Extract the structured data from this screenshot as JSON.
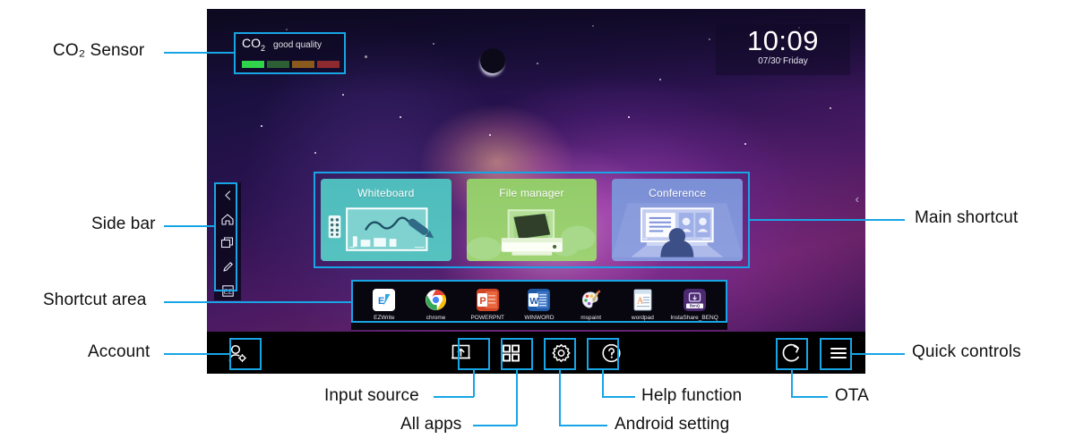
{
  "annotations": {
    "co2_sensor": "CO₂ Sensor",
    "side_bar": "Side bar",
    "shortcut_area": "Shortcut area",
    "account": "Account",
    "main_shortcut": "Main shortcut",
    "quick_controls": "Quick controls",
    "input_source": "Input source",
    "all_apps": "All apps",
    "android_setting": "Android setting",
    "help_function": "Help function",
    "ota": "OTA"
  },
  "colors": {
    "accent": "#18a5e6",
    "co2_good": "#2fd44a",
    "co2_fair": "#2f6a34",
    "co2_poor": "#8a5a1c",
    "co2_bad": "#93272c",
    "tile_whiteboard": "#4fbcbd",
    "tile_filemanager": "#93cc6a",
    "tile_conference": "#7b8fd6"
  },
  "screen": {
    "co2_widget": {
      "label": "CO",
      "label_sub": "2",
      "quality": "good quality",
      "levels": [
        "good",
        "fair",
        "poor",
        "bad"
      ],
      "active_level": 0
    },
    "clock": {
      "time": "10:09",
      "date": "07/30 Friday"
    },
    "sidebar": {
      "items": [
        {
          "name": "collapse",
          "icon": "chevron-left-icon"
        },
        {
          "name": "home",
          "icon": "home-icon"
        },
        {
          "name": "recent",
          "icon": "windows-icon"
        },
        {
          "name": "annotate",
          "icon": "pen-icon"
        },
        {
          "name": "ezwrite",
          "icon": "ez-icon"
        }
      ],
      "edge_chevron": "‹"
    },
    "main_shortcut": {
      "tiles": [
        {
          "title": "Whiteboard",
          "key": "whiteboard"
        },
        {
          "title": "File manager",
          "key": "file-manager"
        },
        {
          "title": "Conference",
          "key": "conference"
        }
      ]
    },
    "shortcut_area": {
      "apps": [
        {
          "label": "EZWrite",
          "icon": "ezwrite-icon"
        },
        {
          "label": "chrome",
          "icon": "chrome-icon"
        },
        {
          "label": "POWERPNT",
          "icon": "powerpoint-icon"
        },
        {
          "label": "WINWORD",
          "icon": "word-icon"
        },
        {
          "label": "mspaint",
          "icon": "paint-icon"
        },
        {
          "label": "wordpad",
          "icon": "wordpad-icon"
        },
        {
          "label": "InstaShare_BENQ",
          "icon": "instashare-icon"
        }
      ]
    },
    "bottom_bar": {
      "account": {
        "name": "account-button",
        "icon": "person-gear-icon"
      },
      "input_source": {
        "name": "input-source-button",
        "icon": "input-source-icon"
      },
      "all_apps": {
        "name": "all-apps-button",
        "icon": "grid-icon"
      },
      "android_setting": {
        "name": "android-setting-button",
        "icon": "gear-icon"
      },
      "help": {
        "name": "help-button",
        "icon": "question-circle-icon"
      },
      "ota": {
        "name": "ota-button",
        "icon": "refresh-icon"
      },
      "quick_controls": {
        "name": "quick-controls-button",
        "icon": "hamburger-icon"
      }
    }
  }
}
